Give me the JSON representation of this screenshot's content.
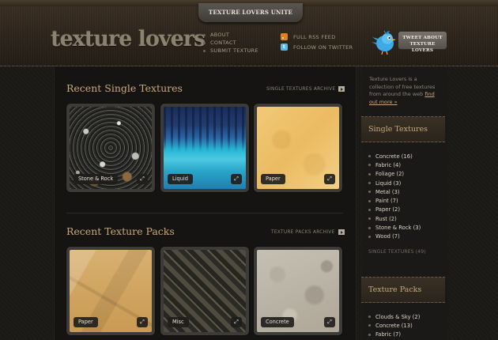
{
  "header": {
    "tab_label": "TEXTURE LOVERS UNITE",
    "logo_text": "texture lovers",
    "nav": [
      {
        "label": "ABOUT"
      },
      {
        "label": "CONTACT"
      },
      {
        "label": "SUBMIT TEXTURE"
      }
    ],
    "feeds": [
      {
        "label": "FULL RSS FEED",
        "icon": "rss-icon"
      },
      {
        "label": "FOLLOW ON TWITTER",
        "icon": "twitter-icon"
      }
    ],
    "tweet_button": {
      "line1": "TWEET ABOUT",
      "line2": "TEXTURE LOVERS"
    }
  },
  "main": {
    "singles": {
      "title": "Recent Single Textures",
      "archive_label": "SINGLE TEXTURES ARCHIVE",
      "cards": [
        {
          "label": "Stone & Rock",
          "zoom": "⤢"
        },
        {
          "label": "Liquid",
          "zoom": "⤢"
        },
        {
          "label": "Paper",
          "zoom": "⤢"
        }
      ]
    },
    "packs": {
      "title": "Recent Texture Packs",
      "archive_label": "TEXTURE PACKS ARCHIVE",
      "cards": [
        {
          "label": "Paper",
          "zoom": "⤢"
        },
        {
          "label": "Misc",
          "zoom": "⤢"
        },
        {
          "label": "Concrete",
          "zoom": "⤢"
        }
      ]
    }
  },
  "sidebar": {
    "intro": {
      "text": "Texture Lovers is a collection of free textures from around the web ",
      "link": "find out more »"
    },
    "single_textures": {
      "title": "Single Textures",
      "items": [
        {
          "label": "Concrete (16)"
        },
        {
          "label": "Fabric (4)"
        },
        {
          "label": "Foliage (2)"
        },
        {
          "label": "Liquid (3)"
        },
        {
          "label": "Metal (3)"
        },
        {
          "label": "Paint (7)"
        },
        {
          "label": "Paper (2)"
        },
        {
          "label": "Rust (2)"
        },
        {
          "label": "Stone & Rock (3)"
        },
        {
          "label": "Wood (7)"
        }
      ],
      "all_link": "SINGLE TEXTURES (49)"
    },
    "texture_packs": {
      "title": "Texture Packs",
      "items": [
        {
          "label": "Clouds & Sky (2)"
        },
        {
          "label": "Concrete (13)"
        },
        {
          "label": "Fabric (7)"
        }
      ]
    }
  },
  "colors": {
    "accent": "#c9a97a",
    "background": "#1b1a17",
    "header": "#2c241b"
  }
}
